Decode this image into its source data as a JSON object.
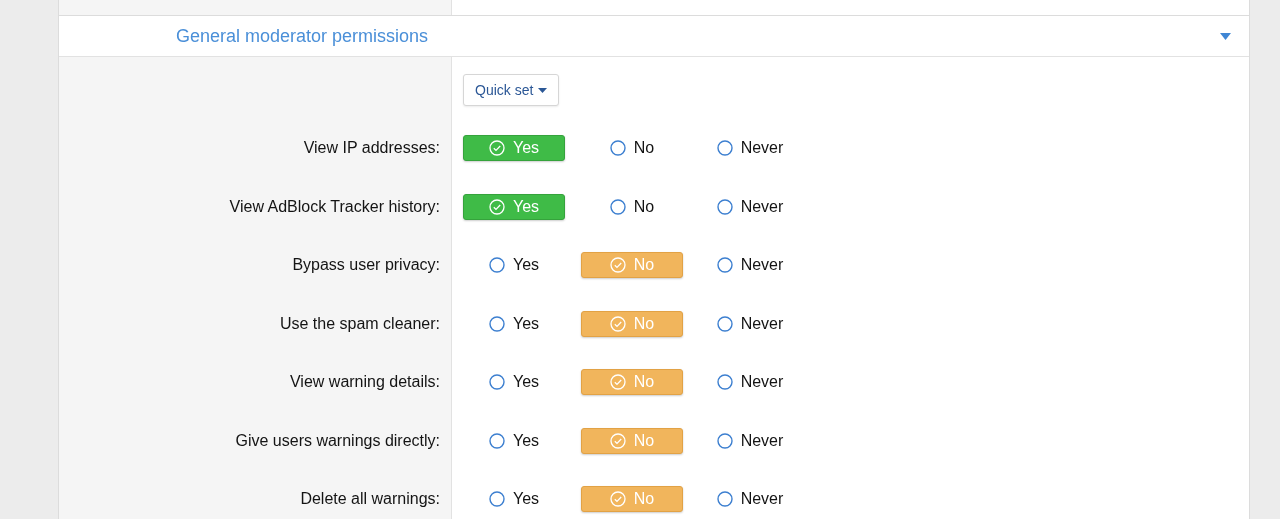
{
  "section": {
    "title": "General moderator permissions",
    "expanded": true
  },
  "quick_set": {
    "label": "Quick set"
  },
  "permissions": [
    {
      "label": "View IP addresses:",
      "options": [
        {
          "kind": "yes",
          "label": "Yes",
          "selected": true
        },
        {
          "kind": "no",
          "label": "No",
          "selected": false
        },
        {
          "kind": "never",
          "label": "Never",
          "selected": false
        }
      ]
    },
    {
      "label": "View AdBlock Tracker history:",
      "options": [
        {
          "kind": "yes",
          "label": "Yes",
          "selected": true
        },
        {
          "kind": "no",
          "label": "No",
          "selected": false
        },
        {
          "kind": "never",
          "label": "Never",
          "selected": false
        }
      ]
    },
    {
      "label": "Bypass user privacy:",
      "options": [
        {
          "kind": "yes",
          "label": "Yes",
          "selected": false
        },
        {
          "kind": "no",
          "label": "No",
          "selected": true
        },
        {
          "kind": "never",
          "label": "Never",
          "selected": false
        }
      ]
    },
    {
      "label": "Use the spam cleaner:",
      "options": [
        {
          "kind": "yes",
          "label": "Yes",
          "selected": false
        },
        {
          "kind": "no",
          "label": "No",
          "selected": true
        },
        {
          "kind": "never",
          "label": "Never",
          "selected": false
        }
      ]
    },
    {
      "label": "View warning details:",
      "options": [
        {
          "kind": "yes",
          "label": "Yes",
          "selected": false
        },
        {
          "kind": "no",
          "label": "No",
          "selected": true
        },
        {
          "kind": "never",
          "label": "Never",
          "selected": false
        }
      ]
    },
    {
      "label": "Give users warnings directly:",
      "options": [
        {
          "kind": "yes",
          "label": "Yes",
          "selected": false
        },
        {
          "kind": "no",
          "label": "No",
          "selected": true
        },
        {
          "kind": "never",
          "label": "Never",
          "selected": false
        }
      ]
    },
    {
      "label": "Delete all warnings:",
      "options": [
        {
          "kind": "yes",
          "label": "Yes",
          "selected": false
        },
        {
          "kind": "no",
          "label": "No",
          "selected": true
        },
        {
          "kind": "never",
          "label": "Never",
          "selected": false
        }
      ]
    }
  ]
}
